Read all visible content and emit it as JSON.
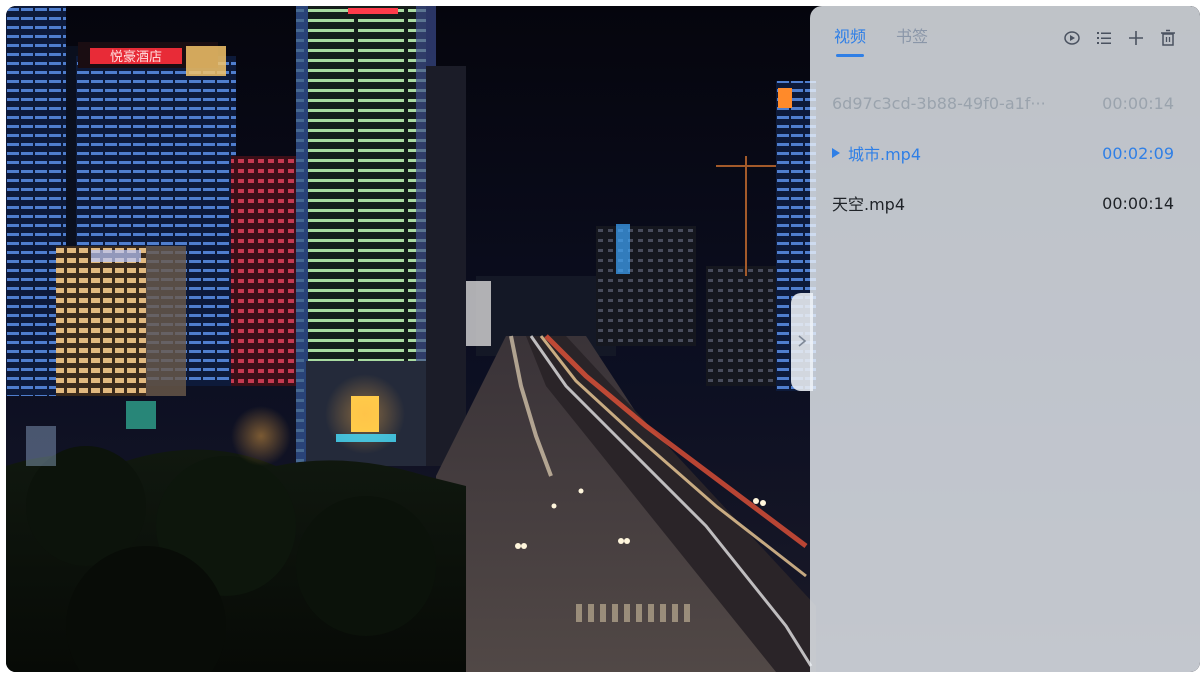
{
  "playlist": {
    "tabs": [
      {
        "label": "视频",
        "active": true
      },
      {
        "label": "书签",
        "active": false
      }
    ],
    "tools": {
      "icons": [
        "loop-mode-icon",
        "list-order-icon",
        "add-icon",
        "delete-icon"
      ]
    },
    "items": [
      {
        "name": "6d97c3cd-3b88-49f0-a1f···",
        "duration": "00:00:14",
        "state": "dim"
      },
      {
        "name": "城市.mp4",
        "duration": "00:02:09",
        "state": "playing"
      },
      {
        "name": "天空.mp4",
        "duration": "00:00:14",
        "state": "normal"
      }
    ],
    "handle_icon": "chevron-right-icon"
  },
  "video": {
    "signs": [
      "悦豪酒店"
    ]
  },
  "colors": {
    "accent": "#2f7fe6",
    "panel_bg": "#eef2f8"
  }
}
